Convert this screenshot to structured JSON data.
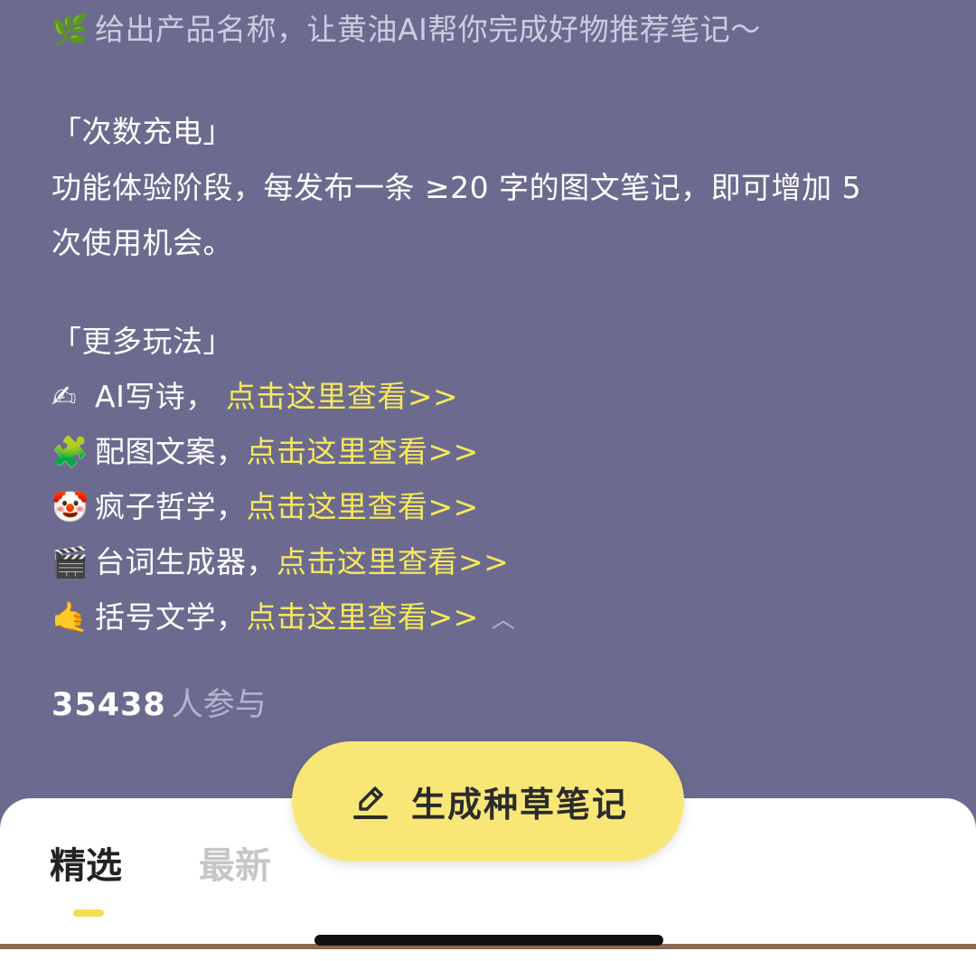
{
  "intro": {
    "emoji": "🌿",
    "text": "给出产品名称，让黄油AI帮你完成好物推荐笔记～"
  },
  "recharge": {
    "heading": "「次数充电」",
    "line1": "功能体验阶段，每发布一条 ≥20 字的图文笔记，即可增加 5",
    "line2": "次使用机会。"
  },
  "more": {
    "heading": "「更多玩法」",
    "items": [
      {
        "emoji": "✍",
        "label": "AI写诗，",
        "link": "点击这里查看>>"
      },
      {
        "emoji": "🧩",
        "label": "配图文案，",
        "link": "点击这里查看>>"
      },
      {
        "emoji": "🤡",
        "label": "疯子哲学，",
        "link": "点击这里查看>>"
      },
      {
        "emoji": "🎬",
        "label": "台词生成器，",
        "link": "点击这里查看>>"
      },
      {
        "emoji": "🤙",
        "label": "括号文学，",
        "link": "点击这里查看>>"
      }
    ],
    "collapse_icon": "chevron-up-icon"
  },
  "participants": {
    "count": "35438",
    "label": "人参与"
  },
  "cta": {
    "label": "生成种草笔记",
    "icon": "edit-pencil-icon"
  },
  "tabs": [
    {
      "label": "精选",
      "selected": true
    },
    {
      "label": "最新",
      "selected": false
    }
  ],
  "colors": {
    "background": "#6c6b8f",
    "link": "#f6e75c",
    "cta": "#f8e776",
    "tab_indicator": "#f5dc56"
  }
}
